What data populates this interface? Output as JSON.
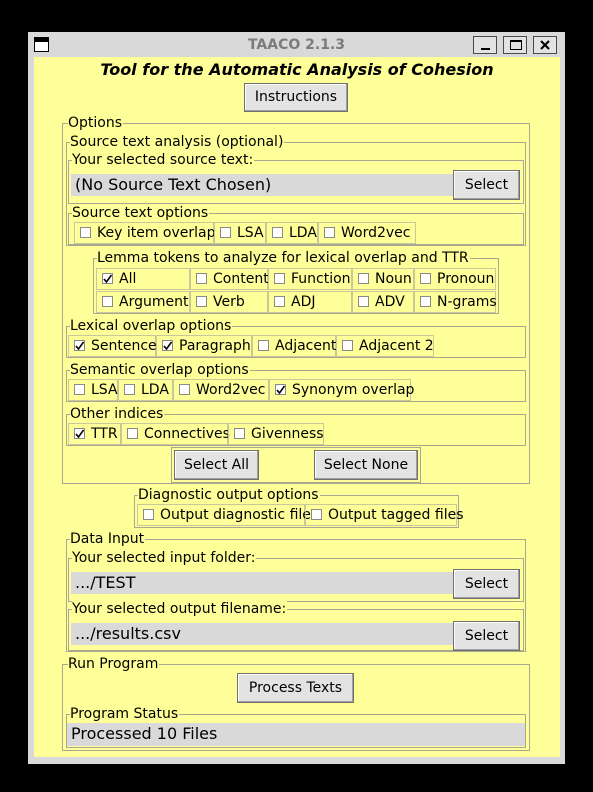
{
  "window": {
    "title": "TAACO 2.1.3",
    "heading": "Tool for the Automatic Analysis of Cohesion",
    "menu_icon": "window-menu-icon",
    "controls": [
      "minimize-icon",
      "maximize-icon",
      "close-icon"
    ]
  },
  "instructions_label": "Instructions",
  "options": {
    "label": "Options",
    "source_analysis": {
      "label": "Source text analysis (optional)",
      "selected_label": "Your selected source text:",
      "selected_value": "(No Source Text Chosen)",
      "select_label": "Select",
      "source_options_label": "Source text options",
      "items": [
        {
          "label": "Key item overlap",
          "checked": false
        },
        {
          "label": "LSA",
          "checked": false
        },
        {
          "label": "LDA",
          "checked": false
        },
        {
          "label": "Word2vec",
          "checked": false
        }
      ]
    },
    "lemma": {
      "label": "Lemma tokens to analyze for lexical overlap and TTR",
      "items": [
        {
          "label": "All",
          "checked": true
        },
        {
          "label": "Content",
          "checked": false
        },
        {
          "label": "Function",
          "checked": false
        },
        {
          "label": "Noun",
          "checked": false
        },
        {
          "label": "Pronoun",
          "checked": false
        },
        {
          "label": "Argument",
          "checked": false
        },
        {
          "label": "Verb",
          "checked": false
        },
        {
          "label": "ADJ",
          "checked": false
        },
        {
          "label": "ADV",
          "checked": false
        },
        {
          "label": "N-grams",
          "checked": false
        }
      ]
    },
    "lexical": {
      "label": "Lexical overlap options",
      "items": [
        {
          "label": "Sentence",
          "checked": true
        },
        {
          "label": "Paragraph",
          "checked": true
        },
        {
          "label": "Adjacent",
          "checked": false
        },
        {
          "label": "Adjacent 2",
          "checked": false
        }
      ]
    },
    "semantic": {
      "label": "Semantic overlap options",
      "items": [
        {
          "label": "LSA",
          "checked": false
        },
        {
          "label": "LDA",
          "checked": false
        },
        {
          "label": "Word2vec",
          "checked": false
        },
        {
          "label": "Synonym overlap",
          "checked": true
        }
      ]
    },
    "other": {
      "label": "Other indices",
      "items": [
        {
          "label": "TTR",
          "checked": true
        },
        {
          "label": "Connectives",
          "checked": false
        },
        {
          "label": "Givenness",
          "checked": false
        }
      ]
    },
    "select_all_label": "Select All",
    "select_none_label": "Select None"
  },
  "diagnostic": {
    "label": "Diagnostic output options",
    "items": [
      {
        "label": "Output diagnostic file",
        "checked": false
      },
      {
        "label": "Output tagged files",
        "checked": false
      }
    ]
  },
  "data_input": {
    "label": "Data Input",
    "input_label": "Your selected input folder:",
    "input_value": ".../TEST",
    "output_label": "Your selected output filename:",
    "output_value": ".../results.csv",
    "select_label": "Select"
  },
  "run": {
    "label": "Run Program",
    "process_label": "Process Texts",
    "status_label": "Program Status",
    "status_value": "Processed 10 Files"
  },
  "colors": {
    "panel_bg": "#ffff99",
    "chrome": "#d9d9d9",
    "title_text": "#7b7b7b"
  }
}
